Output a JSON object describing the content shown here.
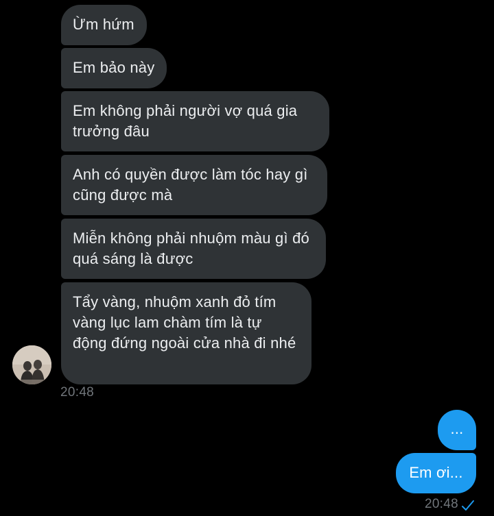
{
  "incoming": {
    "messages": [
      "Ừm hứm",
      "Em bảo này",
      "Em không phải người vợ quá gia trưởng đâu",
      "Anh có quyền được làm tóc hay gì cũng được mà",
      "Miễn không phải nhuộm màu gì đó quá sáng là được",
      "Tẩy vàng, nhuộm xanh đỏ tím vàng lục lam chàm tím là tự động đứng ngoài cửa nhà đi nhé"
    ],
    "timestamp": "20:48"
  },
  "outgoing": {
    "messages": [
      "...",
      "Em ơi..."
    ],
    "timestamp": "20:48",
    "status_icon": "read-check-icon"
  },
  "colors": {
    "background": "#000000",
    "incoming_bubble": "#2f3336",
    "outgoing_bubble": "#1d9bf0",
    "timestamp": "#71767b",
    "check": "#1d9bf0"
  }
}
